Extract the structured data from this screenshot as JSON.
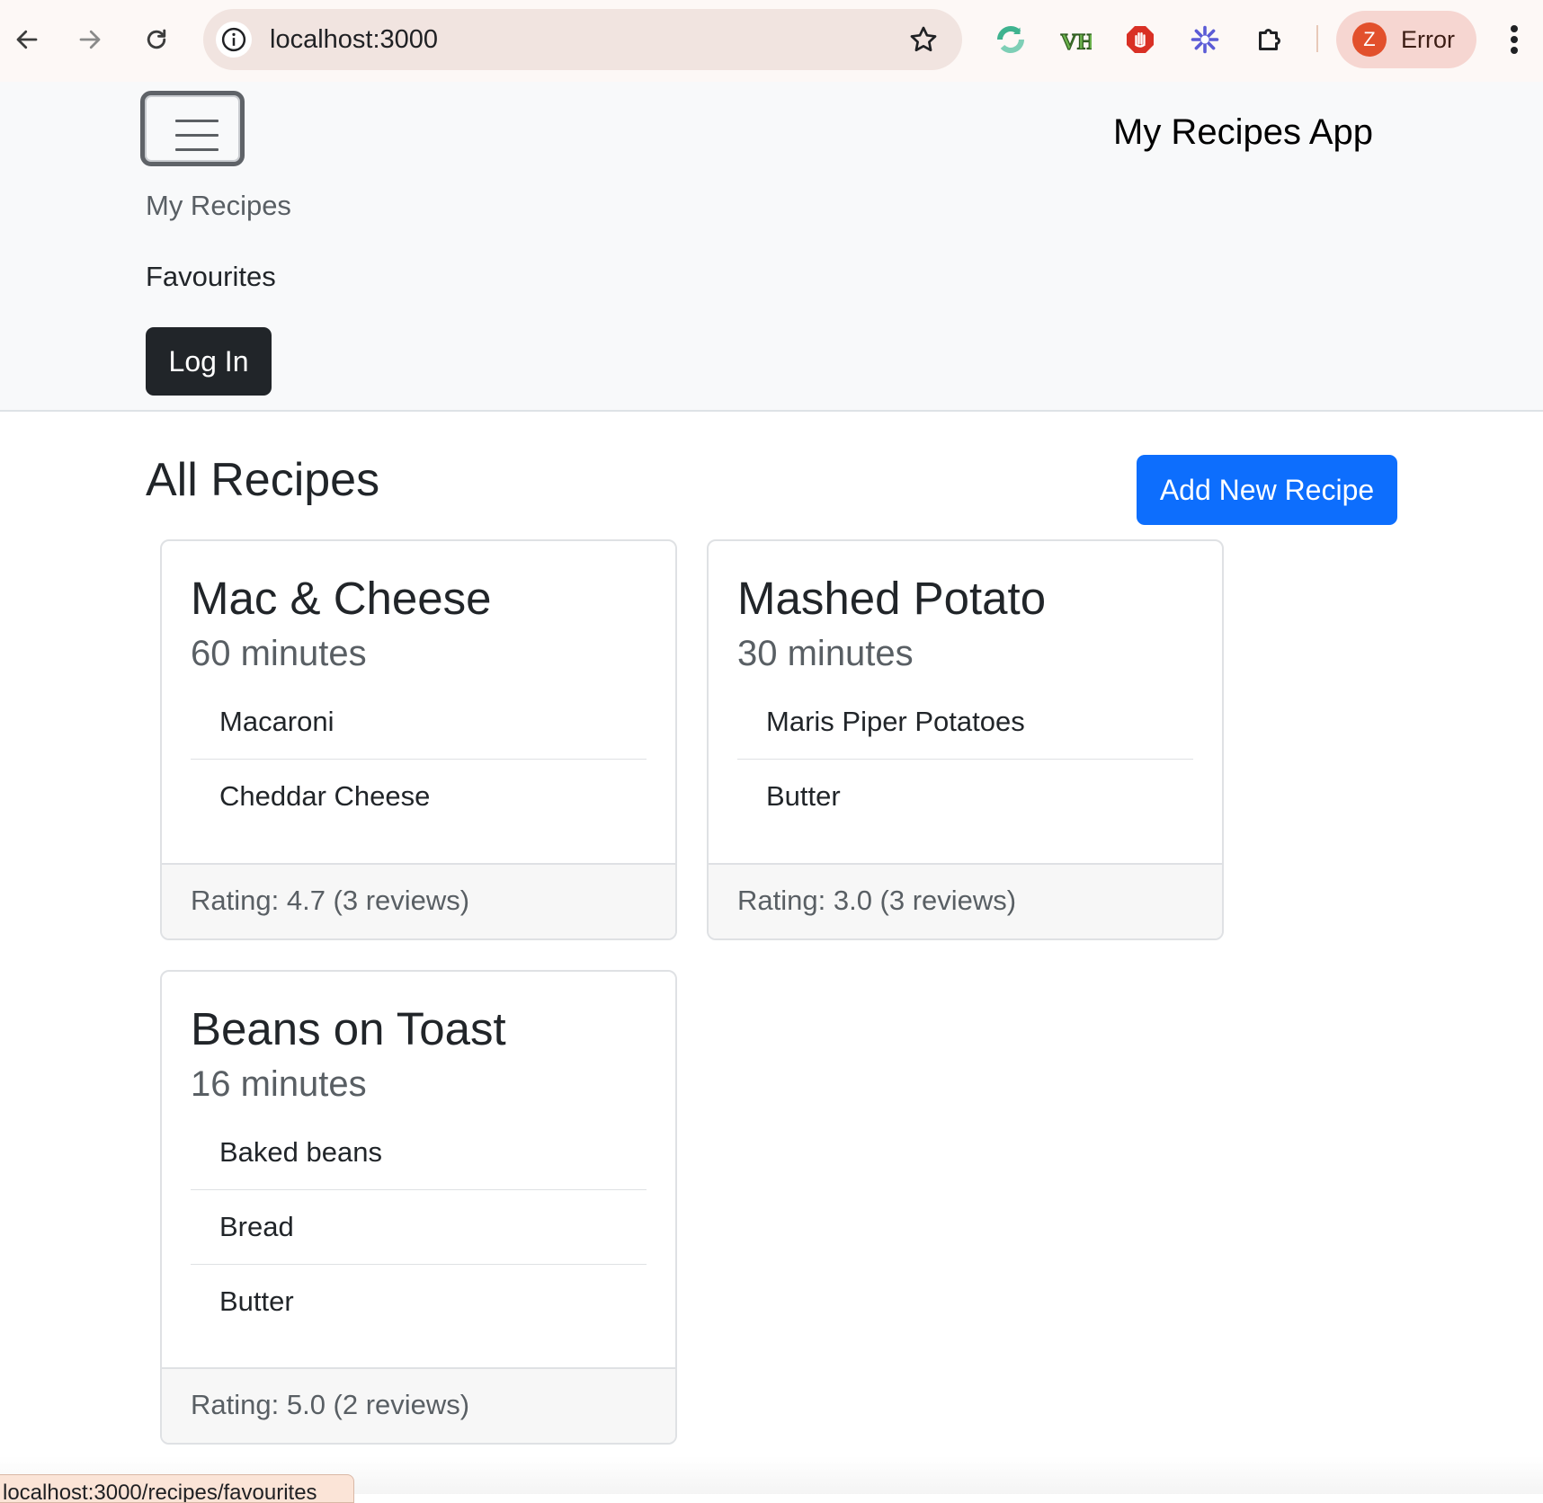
{
  "browser": {
    "url": "localhost:3000",
    "profile_initial": "Z",
    "profile_label": "Error",
    "status_url": "localhost:3000/recipes/favourites"
  },
  "navbar": {
    "brand": "My Recipes App",
    "links": [
      "My Recipes",
      "Favourites"
    ],
    "login_label": "Log In"
  },
  "main": {
    "title": "All Recipes",
    "add_button_label": "Add New Recipe",
    "recipes": [
      {
        "name": "Mac & Cheese",
        "time": "60 minutes",
        "ingredients": [
          "Macaroni",
          "Cheddar Cheese"
        ],
        "rating": "Rating: 4.7 (3 reviews)"
      },
      {
        "name": "Mashed Potato",
        "time": "30 minutes",
        "ingredients": [
          "Maris Piper Potatoes",
          "Butter"
        ],
        "rating": "Rating: 3.0 (3 reviews)"
      },
      {
        "name": "Beans on Toast",
        "time": "16 minutes",
        "ingredients": [
          "Baked beans",
          "Bread",
          "Butter"
        ],
        "rating": "Rating: 5.0 (2 reviews)"
      }
    ]
  },
  "colors": {
    "primary": "#0d6efd",
    "dark": "#212529",
    "navbar_bg": "#f8f9fa",
    "profile_avatar": "#e2502c"
  },
  "icons": [
    "back-arrow-icon",
    "forward-arrow-icon",
    "reload-icon",
    "info-icon",
    "bookmark-star-icon",
    "sync-extension-icon",
    "vh-extension-icon",
    "stop-hand-extension-icon",
    "asterisk-extension-icon",
    "puzzle-extensions-icon",
    "kebab-menu-icon",
    "hamburger-icon"
  ]
}
